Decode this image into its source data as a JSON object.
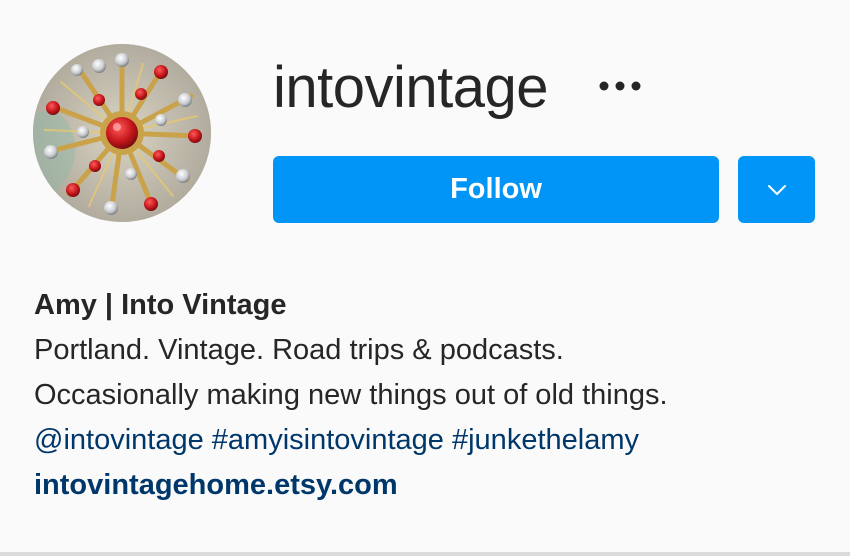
{
  "profile": {
    "username": "intovintage",
    "more_icon": "more-horizontal-icon",
    "follow_label": "Follow",
    "dropdown_icon": "chevron-down-icon",
    "accent_color": "#0095f6",
    "link_color": "#00376b"
  },
  "bio": {
    "name": "Amy | Into Vintage",
    "line1": "Portland. Vintage. Road trips & podcasts.",
    "line2": "Occasionally making new things out of old things.",
    "tags": [
      "@intovintage",
      "#amyisintovintage",
      "#junkethelamy"
    ],
    "link": "intovintagehome.etsy.com"
  }
}
